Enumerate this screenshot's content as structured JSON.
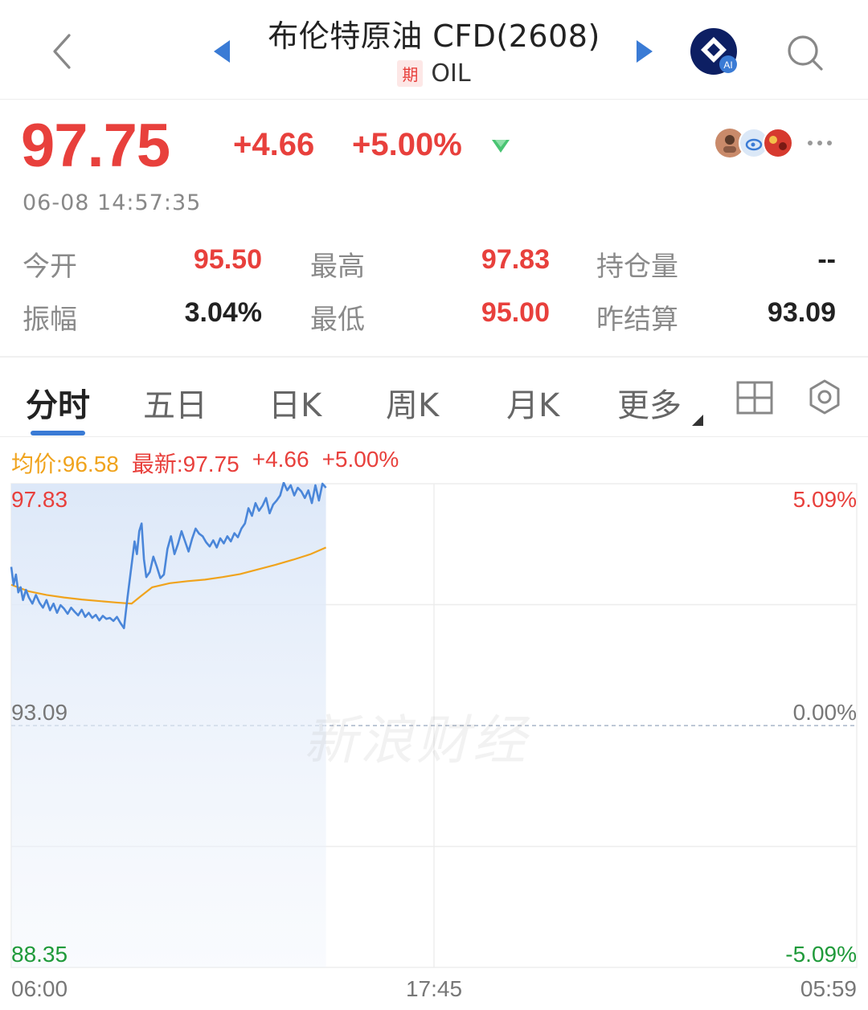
{
  "header": {
    "title": "布伦特原油 CFD(2608)",
    "futures_badge": "期",
    "symbol": "OIL",
    "ai_badge": "AI"
  },
  "quote": {
    "price": "97.75",
    "change": "+4.66",
    "change_pct": "+5.00%",
    "timestamp": "06-08 14:57:35"
  },
  "stats": [
    {
      "label": "今开",
      "value": "95.50",
      "tone": "red"
    },
    {
      "label": "最高",
      "value": "97.83",
      "tone": "red"
    },
    {
      "label": "持仓量",
      "value": "--",
      "tone": "dark"
    },
    {
      "label": "振幅",
      "value": "3.04%",
      "tone": "dark"
    },
    {
      "label": "最低",
      "value": "95.00",
      "tone": "red"
    },
    {
      "label": "昨结算",
      "value": "93.09",
      "tone": "dark"
    }
  ],
  "tabs": [
    {
      "label": "分时",
      "active": true
    },
    {
      "label": "五日",
      "active": false
    },
    {
      "label": "日K",
      "active": false
    },
    {
      "label": "周K",
      "active": false
    },
    {
      "label": "月K",
      "active": false
    },
    {
      "label": "更多",
      "active": false
    }
  ],
  "chart_info": {
    "avg": "均价:96.58",
    "latest": "最新:97.75",
    "change": "+4.66",
    "change_pct": "+5.00%"
  },
  "watermark": "新浪财经",
  "colors": {
    "up": "#e8403c",
    "down": "#1f9a3a",
    "price_line": "#4a86d9",
    "avg_line": "#f0a31c",
    "accent": "#3a7bd5"
  },
  "chart_data": {
    "type": "line",
    "x_ticks": [
      "06:00",
      "17:45",
      "05:59"
    ],
    "y_ticks_left": [
      "97.83",
      "93.09",
      "88.35"
    ],
    "y_ticks_right": [
      "5.09%",
      "0.00%",
      "-5.09%"
    ],
    "ylim": [
      88.35,
      97.83
    ],
    "prev_settle": 93.09,
    "session_minutes": 1440,
    "series": [
      {
        "name": "最新",
        "minute": [
          0,
          4,
          8,
          12,
          16,
          20,
          25,
          30,
          36,
          42,
          48,
          54,
          60,
          66,
          72,
          78,
          84,
          90,
          96,
          102,
          108,
          114,
          120,
          126,
          132,
          138,
          144,
          150,
          156,
          162,
          168,
          174,
          180,
          186,
          192,
          198,
          204,
          210,
          214,
          218,
          222,
          226,
          230,
          236,
          242,
          248,
          254,
          260,
          266,
          272,
          278,
          284,
          290,
          296,
          302,
          308,
          314,
          320,
          326,
          332,
          338,
          344,
          350,
          356,
          362,
          368,
          374,
          380,
          386,
          392,
          398,
          404,
          410,
          416,
          422,
          428,
          434,
          440,
          446,
          452,
          458,
          464,
          470,
          476,
          482,
          488,
          494,
          500,
          506,
          512,
          518,
          524,
          530,
          536
        ],
        "values": [
          96.2,
          95.85,
          96.05,
          95.7,
          95.8,
          95.55,
          95.75,
          95.6,
          95.48,
          95.65,
          95.5,
          95.4,
          95.55,
          95.35,
          95.48,
          95.3,
          95.45,
          95.38,
          95.28,
          95.4,
          95.32,
          95.25,
          95.36,
          95.22,
          95.3,
          95.2,
          95.26,
          95.15,
          95.24,
          95.18,
          95.2,
          95.14,
          95.22,
          95.1,
          95.0,
          95.6,
          96.15,
          96.7,
          96.45,
          96.9,
          97.05,
          96.35,
          96.0,
          96.1,
          96.4,
          96.2,
          95.98,
          96.05,
          96.55,
          96.8,
          96.45,
          96.65,
          96.9,
          96.7,
          96.5,
          96.75,
          96.95,
          96.85,
          96.8,
          96.68,
          96.6,
          96.72,
          96.58,
          96.76,
          96.66,
          96.8,
          96.7,
          96.86,
          96.78,
          96.95,
          97.05,
          97.35,
          97.2,
          97.45,
          97.3,
          97.4,
          97.55,
          97.25,
          97.42,
          97.5,
          97.6,
          97.85,
          97.7,
          97.8,
          97.6,
          97.75,
          97.68,
          97.55,
          97.7,
          97.45,
          97.8,
          97.5,
          97.83,
          97.75
        ]
      },
      {
        "name": "均价",
        "minute": [
          0,
          30,
          60,
          90,
          120,
          150,
          180,
          205,
          220,
          240,
          270,
          300,
          330,
          360,
          390,
          420,
          450,
          480,
          510,
          536
        ],
        "values": [
          95.85,
          95.72,
          95.65,
          95.6,
          95.56,
          95.53,
          95.5,
          95.48,
          95.62,
          95.8,
          95.88,
          95.92,
          95.95,
          96.0,
          96.06,
          96.15,
          96.24,
          96.34,
          96.45,
          96.58
        ]
      }
    ],
    "grid": true
  }
}
